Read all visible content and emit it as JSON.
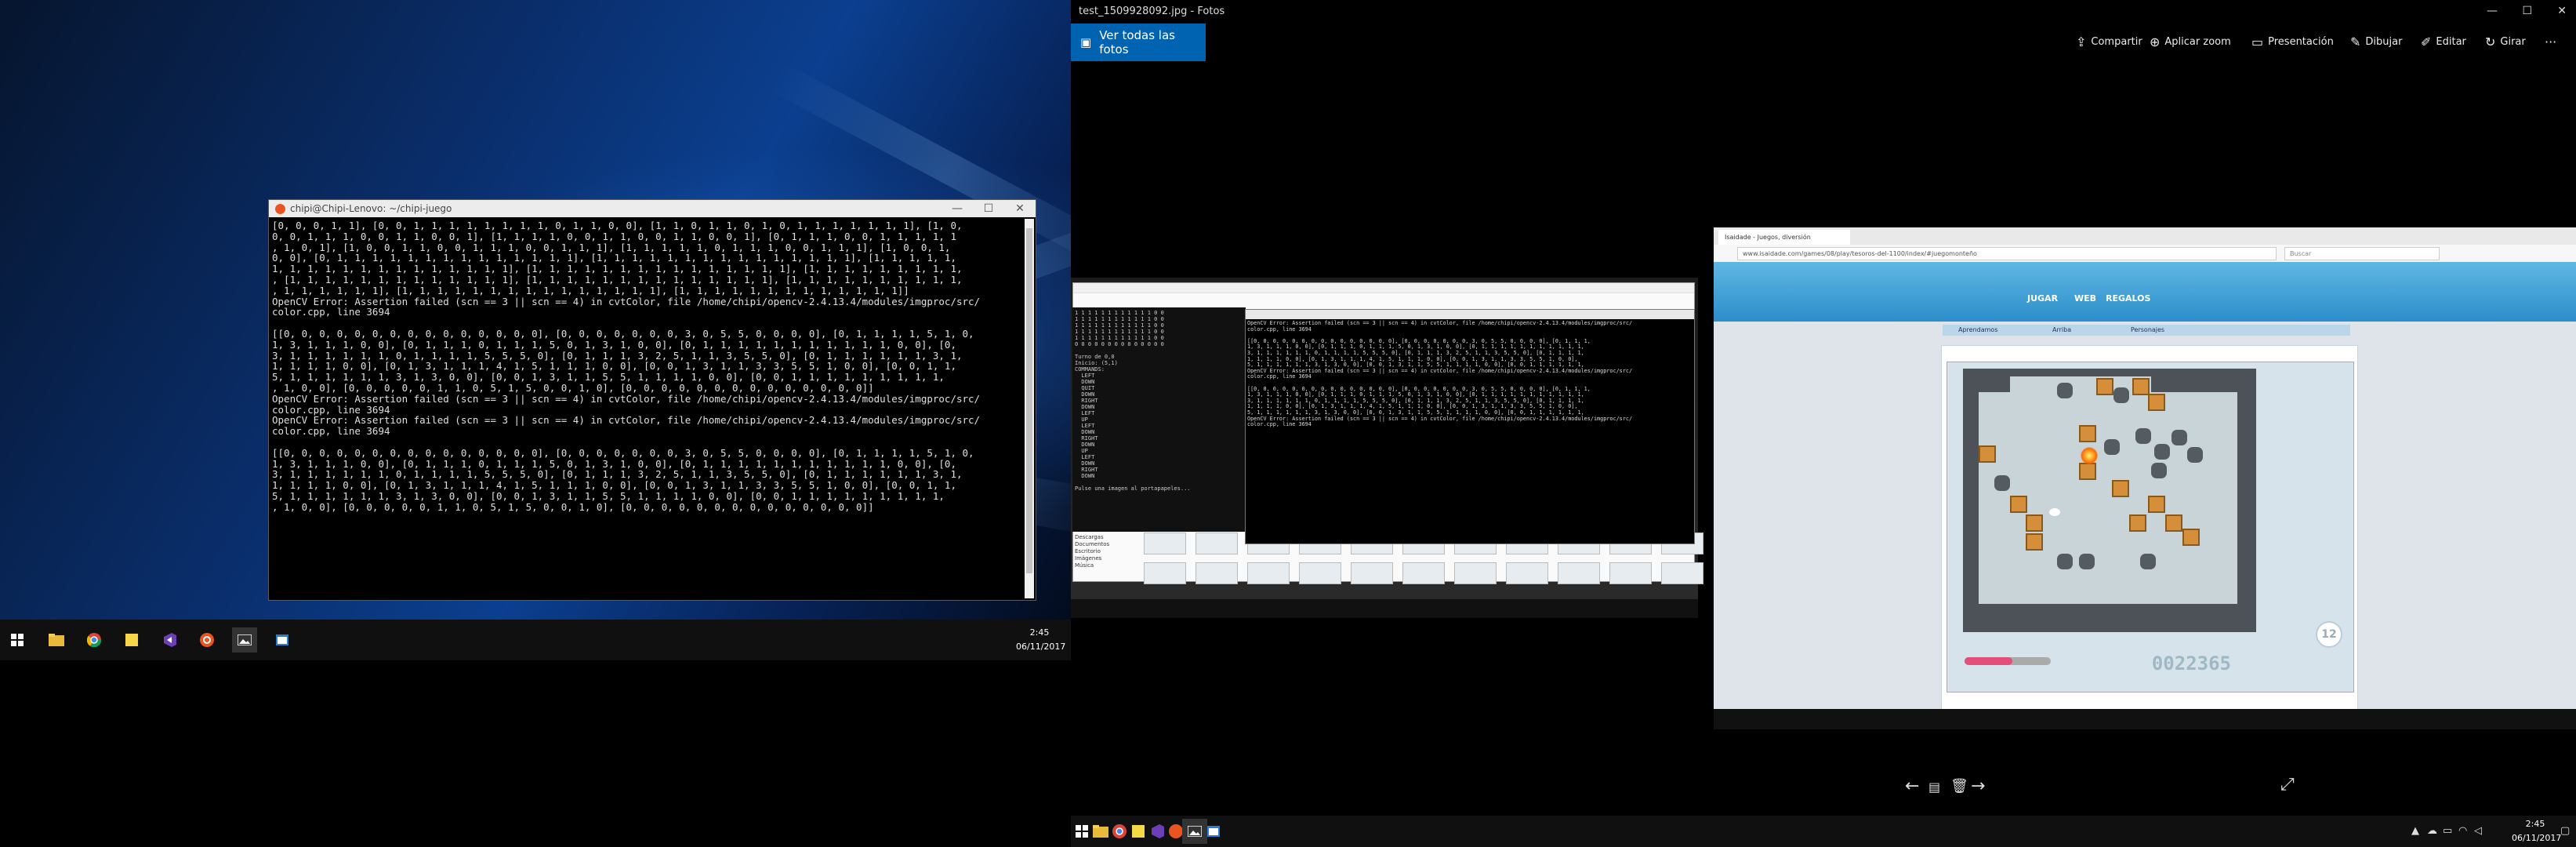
{
  "left": {
    "terminal": {
      "title": "chipi@Chipi-Lenovo: ~/chipi-juego",
      "lines": [
        "[0, 0, 0, 1, 1], [0, 0, 1, 1, 1, 1, 1, 1, 1, 1, 0, 1, 1, 0, 0], [1, 1, 0, 1, 1, 0, 1, 0, 1, 1, 1, 1, 1, 1, 1], [1, 0,",
        "0, 0, 1, 1, 1, 0, 0, 1, 1, 0, 0, 1], [1, 1, 1, 1, 0, 0, 1, 1, 0, 0, 1, 1, 0, 0, 1], [0, 1, 1, 1, 0, 0, 1, 1, 1, 1, 1",
        ", 1, 0, 1], [1, 0, 0, 1, 1, 0, 0, 1, 1, 1, 0, 0, 1, 1, 1], [1, 1, 1, 1, 1, 0, 1, 1, 1, 0, 0, 1, 1, 1], [1, 0, 0, 1,",
        "0, 0], [0, 1, 1, 1, 1, 1, 1, 1, 1, 1, 1, 1, 1, 1, 1], [1, 1, 1, 1, 1, 1, 1, 1, 1, 1, 1, 1, 1, 1, 1], [1, 1, 1, 1, 1,",
        "1, 1, 1, 1, 1, 1, 1, 1, 1, 1, 1, 1, 1, 1], [1, 1, 1, 1, 1, 1, 1, 1, 1, 1, 1, 1, 1, 1, 1], [1, 1, 1, 1, 1, 1, 1, 1, 1,",
        ", [1, 1, 1, 1, 1, 1, 1, 1, 1, 1, 1, 1, 1], [1, 1, 1, 1, 1, 1, 1, 1, 1, 1, 1, 1, 1, 1], [1, 1, 1, 1, 1, 1, 1, 1, 1, 1,",
        ", 1, 1, 1, 1, 1, 1], [1, 1, 1, 1, 1, 1, 1, 1, 1, 1, 1, 1, 1, 1, 1], [1, 1, 1, 1, 1, 1, 1, 1, 1, 1, 1, 1, 1]]",
        "OpenCV Error: Assertion failed (scn == 3 || scn == 4) in cvtColor, file /home/chipi/opencv-2.4.13.4/modules/imgproc/src/",
        "color.cpp, line 3694",
        "",
        "[[0, 0, 0, 0, 0, 0, 0, 0, 0, 0, 0, 0, 0, 0, 0], [0, 0, 0, 0, 0, 0, 0, 3, 0, 5, 5, 0, 0, 0, 0], [0, 1, 1, 1, 1, 5, 1, 0,",
        "1, 3, 1, 1, 1, 0, 0], [0, 1, 1, 1, 0, 1, 1, 1, 5, 0, 1, 3, 1, 0, 0], [0, 1, 1, 1, 1, 1, 1, 1, 1, 1, 1, 1, 0, 0], [0,",
        "3, 1, 1, 1, 1, 1, 1, 0, 1, 1, 1, 1, 5, 5, 5, 0], [0, 1, 1, 1, 3, 2, 5, 1, 1, 3, 5, 5, 0], [0, 1, 1, 1, 1, 1, 1, 3, 1,",
        "1, 1, 1, 1, 0, 0], [0, 1, 3, 1, 1, 1, 4, 1, 5, 1, 1, 1, 0, 0], [0, 0, 1, 3, 1, 1, 3, 3, 5, 5, 1, 0, 0], [0, 0, 1, 1,",
        "5, 1, 1, 1, 1, 1, 1, 3, 1, 3, 0, 0], [0, 0, 1, 3, 1, 1, 5, 5, 1, 1, 1, 1, 0, 0], [0, 0, 1, 1, 1, 1, 1, 1, 1, 1, 1,",
        ", 1, 0, 0], [0, 0, 0, 0, 0, 1, 1, 0, 5, 1, 5, 0, 0, 1, 0], [0, 0, 0, 0, 0, 0, 0, 0, 0, 0, 0, 0, 0, 0]]",
        "OpenCV Error: Assertion failed (scn == 3 || scn == 4) in cvtColor, file /home/chipi/opencv-2.4.13.4/modules/imgproc/src/",
        "color.cpp, line 3694",
        "OpenCV Error: Assertion failed (scn == 3 || scn == 4) in cvtColor, file /home/chipi/opencv-2.4.13.4/modules/imgproc/src/",
        "color.cpp, line 3694",
        "",
        "[[0, 0, 0, 0, 0, 0, 0, 0, 0, 0, 0, 0, 0, 0, 0], [0, 0, 0, 0, 0, 0, 0, 3, 0, 5, 5, 0, 0, 0, 0], [0, 1, 1, 1, 1, 5, 1, 0,",
        "1, 3, 1, 1, 1, 0, 0], [0, 1, 1, 1, 0, 1, 1, 1, 5, 0, 1, 3, 1, 0, 0], [0, 1, 1, 1, 1, 1, 1, 1, 1, 1, 1, 1, 0, 0], [0,",
        "3, 1, 1, 1, 1, 1, 1, 0, 1, 1, 1, 1, 5, 5, 5, 0], [0, 1, 1, 1, 3, 2, 5, 1, 1, 3, 5, 5, 0], [0, 1, 1, 1, 1, 1, 1, 3, 1,",
        "1, 1, 1, 1, 0, 0], [0, 1, 3, 1, 1, 1, 4, 1, 5, 1, 1, 1, 0, 0], [0, 0, 1, 3, 1, 1, 3, 3, 5, 5, 1, 0, 0], [0, 0, 1, 1,",
        "5, 1, 1, 1, 1, 1, 1, 3, 1, 3, 0, 0], [0, 0, 1, 3, 1, 1, 5, 5, 1, 1, 1, 1, 0, 0], [0, 0, 1, 1, 1, 1, 1, 1, 1, 1, 1,",
        ", 1, 0, 0], [0, 0, 0, 0, 0, 1, 1, 0, 5, 1, 5, 0, 0, 1, 0], [0, 0, 0, 0, 0, 0, 0, 0, 0, 0, 0, 0, 0, 0]]"
      ]
    },
    "taskbar": {
      "time": "2:45",
      "date": "06/11/2017"
    }
  },
  "photos": {
    "title": "test_1509928092.jpg - Fotos",
    "ver_todas": "Ver todas las fotos",
    "tools": {
      "compartir": "Compartir",
      "zoom": "Aplicar zoom",
      "presentacion": "Presentación",
      "dibujar": "Dibujar",
      "editar": "Editar",
      "girar": "Girar"
    }
  },
  "photo": {
    "sub1": {
      "terminal_lines": "1 1 1 1 1 1 1 1 1 1 1 1 0 0\n1 1 1 1 1 1 1 1 1 1 1 1 0 0\n1 1 1 1 1 1 1 1 1 1 1 1 0 0\n1 1 1 1 1 1 1 1 1 1 1 1 0 0\n1 1 1 1 1 1 1 1 1 1 1 1 0 0\n0 0 0 0 0 0 0 0 0 0 0 0 0 0\n\nTurno de 0,0\nInicio: (5,1)\nCOMMANDS:\n  LEFT\n  DOWN\n  QUIT\n  DOWN\n  RIGHT\n  DOWN\n  LEFT\n  UP\n  LEFT\n  DOWN\n  RIGHT\n  DOWN\n  UP\n  LEFT\n  DOWN\n  RIGHT\n  DOWN\n\nPulse una imagen al portapapeles...",
      "terminal2_text": "OpenCV Error: Assertion failed (scn == 3 || scn == 4) in cvtColor, file /home/chipi/opencv-2.4.13.4/modules/imgproc/src/\ncolor.cpp, line 3694\n\n[[0, 0, 0, 0, 0, 0, 0, 0, 0, 0, 0, 0, 0, 0, 0], [0, 0, 0, 0, 0, 0, 0, 3, 0, 5, 5, 0, 0, 0, 0], [0, 1, 1, 1,\n1, 3, 1, 1, 1, 0, 0], [0, 1, 1, 1, 0, 1, 1, 1, 5, 0, 1, 3, 1, 0, 0], [0, 1, 1, 1, 1, 1, 1, 1, 1, 1, 1, 1,\n3, 1, 1, 1, 1, 1, 1, 0, 1, 1, 1, 1, 5, 5, 5, 0], [0, 1, 1, 1, 3, 2, 5, 1, 1, 3, 5, 5, 0], [0, 1, 1, 1, 1,\n1, 1, 1, 1, 0, 0], [0, 1, 3, 1, 1, 1, 4, 1, 5, 1, 1, 1, 0, 0], [0, 0, 1, 3, 1, 1, 3, 3, 5, 5, 1, 0, 0],\n5, 1, 1, 1, 1, 1, 1, 3, 1, 3, 0, 0], [0, 0, 1, 3, 1, 1, 5, 5, 1, 1, 1, 1, 0, 0], [0, 0, 1, 1, 1, 1, 1, 1,\nOpenCV Error: Assertion failed (scn == 3 || scn == 4) in cvtColor, file /home/chipi/opencv-2.4.13.4/modules/imgproc/src/\ncolor.cpp, line 3694\n\n[[0, 0, 0, 0, 0, 0, 0, 0, 0, 0, 0, 0, 0, 0, 0], [0, 0, 0, 0, 0, 0, 0, 3, 0, 5, 5, 0, 0, 0, 0], [0, 1, 1, 1,\n1, 3, 1, 1, 1, 0, 0], [0, 1, 1, 1, 0, 1, 1, 1, 5, 0, 1, 3, 1, 0, 0], [0, 1, 1, 1, 1, 1, 1, 1, 1, 1, 1, 1,\n3, 1, 1, 1, 1, 1, 1, 0, 1, 1, 1, 1, 5, 5, 5, 0], [0, 1, 1, 1, 3, 2, 5, 1, 1, 3, 5, 5, 0], [0, 1, 1, 1, 1,\n1, 1, 1, 1, 0, 0], [0, 1, 3, 1, 1, 1, 4, 1, 5, 1, 1, 1, 0, 0], [0, 0, 1, 3, 1, 1, 3, 3, 5, 5, 1, 0, 0],\n5, 1, 1, 1, 1, 1, 1, 3, 1, 3, 0, 0], [0, 0, 1, 3, 1, 1, 5, 5, 1, 1, 1, 1, 0, 0], [0, 0, 1, 1, 1, 1, 1, 1,\nOpenCV Error: Assertion failed (scn == 3 || scn == 4) in cvtColor, file /home/chipi/opencv-2.4.13.4/modules/imgproc/src/\ncolor.cpp, line 3694",
      "explorer_items": [
        "Descargas",
        "Documentos",
        "Escritorio",
        "Imágenes",
        "Música"
      ]
    },
    "sub2": {
      "tab_title": "Isaidade - Juegos, diversión",
      "url": "www.isaidade.com/games/08/play/tesoros-del-1100/index/#juegomonteño",
      "search_placeholder": "Buscar",
      "nav_items": [
        "Aprendamos",
        "Arriba",
        "Personajes"
      ],
      "menu_labels": [
        "JUGAR",
        "WEB",
        "REGALOS"
      ],
      "score": "0022365",
      "level": "12"
    }
  },
  "taskbar": {
    "time": "2:45",
    "date": "06/11/2017"
  }
}
